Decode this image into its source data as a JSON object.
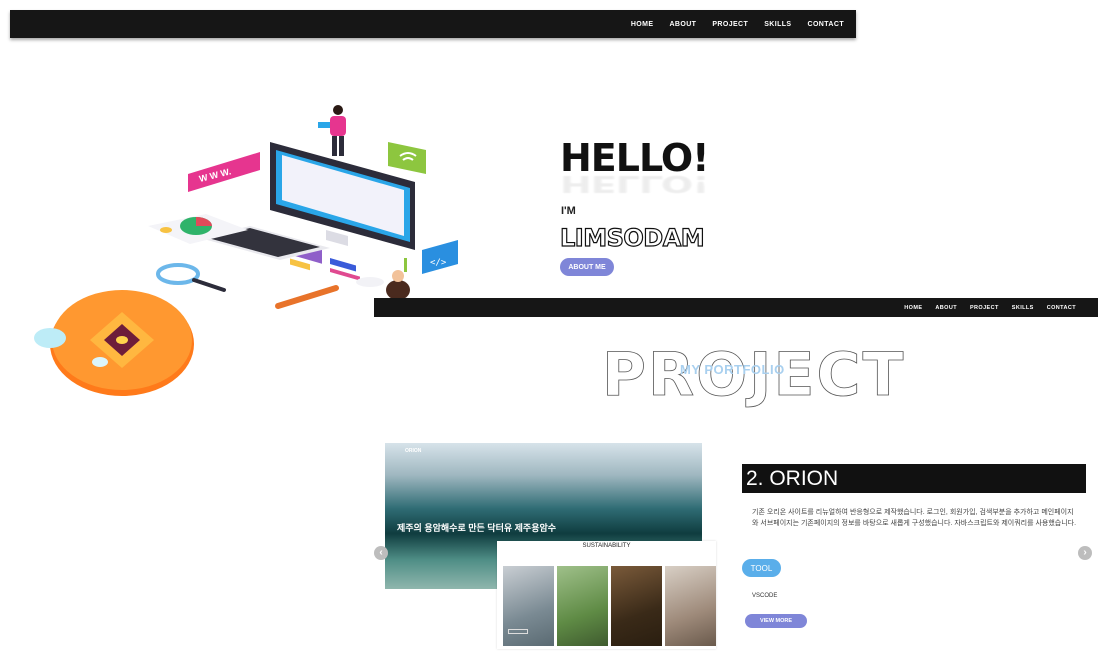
{
  "nav": {
    "items": [
      "HOME",
      "ABOUT",
      "PROJECT",
      "SKILLS",
      "CONTACT"
    ]
  },
  "hero": {
    "greeting": "HELLO!",
    "intro": "I'M",
    "name": "LIMSODAM",
    "button": "ABOUT ME",
    "illustration_label": "W W W."
  },
  "project": {
    "title": "PROJECT",
    "subtitle": "MY PORTFOLIO",
    "preview": {
      "logo": "ORION",
      "headline": "제주의 용암해수로 만든 닥터유 제주용암수",
      "sustainability_title": "SUSTAINABILITY"
    },
    "item_title": "2. ORION",
    "description": "기존 오리온 사이트를 리뉴얼하여 반응형으로 제작했습니다. 로그인, 회원가입, 검색부분을 추가하고 메인페이지와 서브페이지는 기존페이지의 정보를 바탕으로 새롭게 구성했습니다. 자바스크립트와 제이쿼리를 사용했습니다.",
    "tool_button": "TOOL",
    "tool": "VSCODE",
    "view_more": "VIEW MORE"
  },
  "colors": {
    "nav_bg": "#161616",
    "accent_purple": "#7f86d8",
    "accent_blue": "#5aaeea",
    "title_bar": "#111111"
  }
}
